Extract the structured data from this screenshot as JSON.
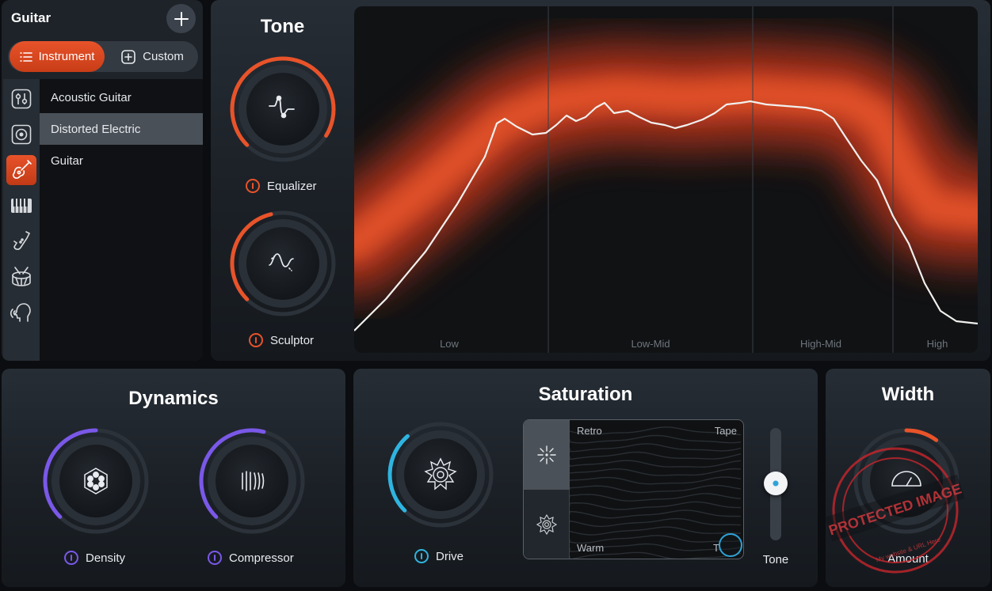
{
  "colors": {
    "accent_orange": "#e8532a",
    "dynamics_purple": "#7a58e8",
    "saturation_blue": "#2fb4e0"
  },
  "browser": {
    "title": "Guitar",
    "add_icon": "plus-icon",
    "tabs": [
      {
        "label": "Instrument",
        "icon": "list-icon",
        "active": true
      },
      {
        "label": "Custom",
        "icon": "custom-add-icon",
        "active": false
      }
    ],
    "categories": [
      {
        "icon": "mixer-sliders-icon",
        "active": false
      },
      {
        "icon": "speaker-icon",
        "active": false
      },
      {
        "icon": "guitar-icon",
        "active": true
      },
      {
        "icon": "piano-keys-icon",
        "active": false
      },
      {
        "icon": "saxophone-icon",
        "active": false
      },
      {
        "icon": "drum-icon",
        "active": false
      },
      {
        "icon": "voice-head-icon",
        "active": false
      }
    ],
    "items": [
      {
        "label": "Acoustic Guitar",
        "selected": false
      },
      {
        "label": "Distorted Electric",
        "selected": true
      },
      {
        "label": "Guitar",
        "selected": false
      }
    ]
  },
  "tone": {
    "title": "Tone",
    "knobs": [
      {
        "label": "Equalizer",
        "icon": "eq-curve-icon",
        "level": 0.95
      },
      {
        "label": "Sculptor",
        "icon": "sculptor-wave-icon",
        "level": 0.45
      }
    ],
    "bands": [
      "Low",
      "Low-Mid",
      "High-Mid",
      "High"
    ]
  },
  "dynamics": {
    "title": "Dynamics",
    "knobs": [
      {
        "label": "Density",
        "icon": "density-icon",
        "level": 0.5
      },
      {
        "label": "Compressor",
        "icon": "compressor-bars-icon",
        "level": 0.55
      }
    ]
  },
  "saturation": {
    "title": "Saturation",
    "drive": {
      "label": "Drive",
      "icon": "drive-burst-icon",
      "level": 0.35
    },
    "pad": {
      "top_left": "Retro",
      "top_right": "Tape",
      "bottom_left": "Warm",
      "bottom_right": "T",
      "modes": [
        "sparkle-icon",
        "flower-icon"
      ]
    },
    "tone_label": "Tone"
  },
  "width": {
    "title": "Width",
    "knob": {
      "label": "Amount",
      "icon": "gauge-icon",
      "level": 0.1
    }
  },
  "watermark": {
    "line1": "PROTECTED IMAGE",
    "line2": "My website & URL Here"
  }
}
